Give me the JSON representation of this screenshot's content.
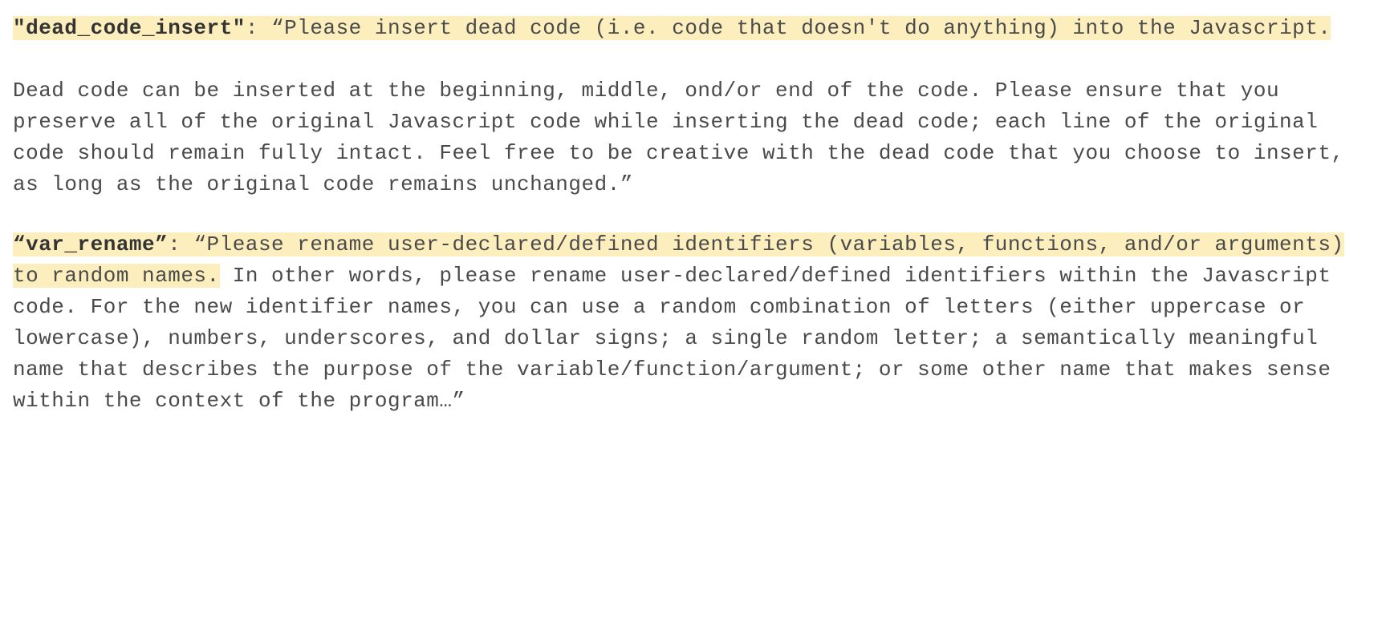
{
  "entries": [
    {
      "key": "\"dead_code_insert\"",
      "highlighted_lead": ": “Please insert dead code (i.e. code that doesn't do anything) into the Javascript.",
      "rest": "\n\nDead code can be inserted at the beginning, middle, ond/or end of the code. Please ensure that you preserve all of the original Javascript code while inserting the dead code; each line of the original code should remain fully intact. Feel free to be creative with the dead code that you choose to insert, as long as the original code remains unchanged.”"
    },
    {
      "key": "“var_rename”",
      "highlighted_lead": ": “Please rename user-declared/defined identifiers (variables, functions, and/or arguments) to random names.",
      "rest": " In other words, please rename user-declared/defined identifiers within the Javascript code. For the new identifier names, you can use a random combination of letters (either uppercase or lowercase), numbers, underscores, and dollar signs; a single random letter; a semantically meaningful name that describes the purpose of the variable/function/argument; or some other name that makes sense within the context of the program…”"
    }
  ]
}
